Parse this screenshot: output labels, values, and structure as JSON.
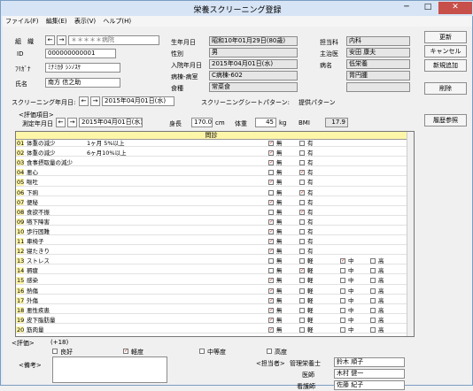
{
  "window": {
    "title": "栄養スクリーニング登録",
    "min": "─",
    "max": "□",
    "close": "✕"
  },
  "menu": [
    "ファイル(F)",
    "編集(E)",
    "表示(V)",
    "ヘルプ(H)"
  ],
  "patient": {
    "ward_label": "組　織",
    "ward_value": "＊＊＊＊＊病院",
    "id_label": "ID",
    "id_value": "000000000001",
    "kana_label": "ﾌﾘｶﾞﾅ",
    "kana_value": "ﾐﾅﾐｶﾀ ｼﾝﾉｽｹ",
    "name_label": "氏名",
    "name_value": "南方 信之助",
    "birth_label": "生年月日",
    "birth_value": "昭和10年01月29日(80歳)",
    "sex_label": "性別",
    "sex_value": "男",
    "admit_label": "入院年月日",
    "admit_value": "2015年04月01日(水)",
    "room_label": "病棟-病室",
    "room_value": "C病棟-602",
    "meal_label": "食種",
    "meal_value": "常菜食",
    "dept_label": "担当科",
    "dept_value": "内科",
    "doctor_label": "主治医",
    "doctor_value": "安田 康夫",
    "disease_label": "病名",
    "disease_value": "低栄養",
    "disease2_value": "胃円腫"
  },
  "buttons": {
    "update": "更新",
    "cancel": "キャンセル",
    "new": "新規追加",
    "delete": "削除",
    "history": "履歴参照"
  },
  "screening": {
    "date_label": "スクリーニング年月日:",
    "date_value": "2015年04月01日(水)",
    "pattern_label": "スクリーニングシートパターン:",
    "pattern_value": "提供パターン"
  },
  "eval": {
    "section_label": "<評価項目>",
    "date_label": "測定年月日",
    "date_value": "2015年04月01日(水)",
    "height_label": "身長",
    "height_value": "170.0",
    "height_unit": "cm",
    "weight_label": "体重",
    "weight_value": "45",
    "weight_unit": "kg",
    "bmi_label": "BMI",
    "bmi_value": "17.9",
    "header": "問診"
  },
  "rows": [
    {
      "no": "01",
      "item": "体重の減少",
      "sub": "1ヶ月 5%以上",
      "opts": [
        [
          "無",
          true
        ],
        [
          "有",
          false
        ]
      ]
    },
    {
      "no": "02",
      "item": "体重の減少",
      "sub": "6ヶ月10%以上",
      "opts": [
        [
          "無",
          true
        ],
        [
          "有",
          false
        ]
      ]
    },
    {
      "no": "03",
      "item": "食事摂取量の減少",
      "sub": "",
      "opts": [
        [
          "無",
          true
        ],
        [
          "有",
          false
        ]
      ]
    },
    {
      "no": "04",
      "item": "悪心",
      "sub": "",
      "opts": [
        [
          "無",
          false
        ],
        [
          "有",
          true
        ]
      ]
    },
    {
      "no": "05",
      "item": "嘔吐",
      "sub": "",
      "opts": [
        [
          "無",
          true
        ],
        [
          "有",
          false
        ]
      ]
    },
    {
      "no": "06",
      "item": "下痢",
      "sub": "",
      "opts": [
        [
          "無",
          false
        ],
        [
          "有",
          true
        ]
      ]
    },
    {
      "no": "07",
      "item": "便秘",
      "sub": "",
      "opts": [
        [
          "無",
          true
        ],
        [
          "有",
          false
        ]
      ]
    },
    {
      "no": "08",
      "item": "食欲不振",
      "sub": "",
      "opts": [
        [
          "無",
          false
        ],
        [
          "有",
          true
        ]
      ]
    },
    {
      "no": "09",
      "item": "嚥下障害",
      "sub": "",
      "opts": [
        [
          "無",
          true
        ],
        [
          "有",
          false
        ]
      ]
    },
    {
      "no": "10",
      "item": "歩行困難",
      "sub": "",
      "opts": [
        [
          "無",
          true
        ],
        [
          "有",
          false
        ]
      ]
    },
    {
      "no": "11",
      "item": "車椅子",
      "sub": "",
      "opts": [
        [
          "無",
          true
        ],
        [
          "有",
          false
        ]
      ]
    },
    {
      "no": "12",
      "item": "寝たきり",
      "sub": "",
      "opts": [
        [
          "無",
          true
        ],
        [
          "有",
          false
        ]
      ]
    },
    {
      "no": "13",
      "item": "ストレス",
      "sub": "",
      "opts": [
        [
          "無",
          false
        ],
        [
          "軽",
          false
        ],
        [
          "中",
          true
        ],
        [
          "高",
          false
        ]
      ]
    },
    {
      "no": "14",
      "item": "褥瘡",
      "sub": "",
      "opts": [
        [
          "無",
          false
        ],
        [
          "軽",
          true
        ],
        [
          "中",
          false
        ],
        [
          "高",
          false
        ]
      ]
    },
    {
      "no": "15",
      "item": "感染",
      "sub": "",
      "opts": [
        [
          "無",
          true
        ],
        [
          "軽",
          false
        ],
        [
          "中",
          false
        ],
        [
          "高",
          false
        ]
      ]
    },
    {
      "no": "16",
      "item": "熱傷",
      "sub": "",
      "opts": [
        [
          "無",
          true
        ],
        [
          "軽",
          false
        ],
        [
          "中",
          false
        ],
        [
          "高",
          false
        ]
      ]
    },
    {
      "no": "17",
      "item": "外傷",
      "sub": "",
      "opts": [
        [
          "無",
          true
        ],
        [
          "軽",
          false
        ],
        [
          "中",
          false
        ],
        [
          "高",
          false
        ]
      ]
    },
    {
      "no": "18",
      "item": "悪性疾患",
      "sub": "",
      "opts": [
        [
          "無",
          true
        ],
        [
          "軽",
          false
        ],
        [
          "中",
          false
        ],
        [
          "高",
          false
        ]
      ]
    },
    {
      "no": "19",
      "item": "皮下脂肪量",
      "sub": "",
      "opts": [
        [
          "無",
          true
        ],
        [
          "軽",
          false
        ],
        [
          "中",
          false
        ],
        [
          "高",
          false
        ]
      ]
    },
    {
      "no": "20",
      "item": "筋肉量",
      "sub": "",
      "opts": [
        [
          "無",
          true
        ],
        [
          "軽",
          false
        ],
        [
          "中",
          false
        ],
        [
          "高",
          false
        ]
      ]
    }
  ],
  "result": {
    "label": "<評価>",
    "score": "(+18)",
    "opts": [
      [
        "良好",
        false
      ],
      [
        "軽度",
        true
      ],
      [
        "中等度",
        false
      ],
      [
        "高度",
        false
      ]
    ]
  },
  "remarks": {
    "label": "<備考>"
  },
  "staff": {
    "label": "<担当者>",
    "r1": "管理栄養士",
    "n1": "鈴木 順子",
    "r2": "医師",
    "n2": "木村 健一",
    "r3": "看護師",
    "n3": "佐藤 紀子"
  }
}
